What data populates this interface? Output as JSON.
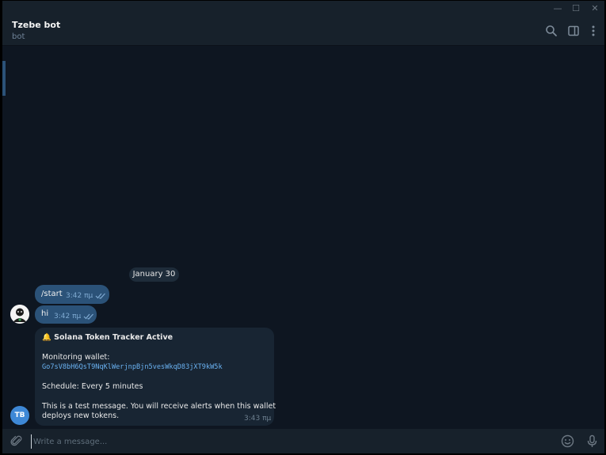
{
  "window": {
    "minimize_glyph": "—",
    "maximize_glyph": "☐",
    "close_glyph": "✕"
  },
  "header": {
    "title": "Tzebe bot",
    "status": "bot",
    "icons": [
      "search-icon",
      "sidebar-toggle-icon",
      "more-vert-icon"
    ]
  },
  "date_separator": "January 30",
  "messages": [
    {
      "text": "/start",
      "time": "3:42 πμ",
      "status": "read"
    },
    {
      "text": "hi",
      "time": "3:42 πμ",
      "status": "read"
    }
  ],
  "bot_message": {
    "title_emoji": "🔔",
    "title": "Solana Token Tracker Active",
    "monitoring_label": "Monitoring wallet:",
    "wallet": "Go7sV8bH6QsT9NqKlWerjnpBjn5vesWkqD83jXT9kW5k",
    "schedule": "Schedule: Every 5 minutes",
    "note_line1": "This is a test message. You will receive alerts when this wallet",
    "note_line2": "deploys new tokens.",
    "time": "3:43 πμ",
    "sender_initials": "TB"
  },
  "composer": {
    "placeholder": "Write a message...",
    "icons": [
      "attach-icon",
      "emoji-icon",
      "microphone-icon"
    ]
  },
  "colors": {
    "background": "#0e1621",
    "panel": "#17212b",
    "outgoing_bubble": "#2b5278",
    "incoming_bubble": "#182533",
    "link": "#6ab2f2",
    "avatar": "#3e88d6"
  }
}
